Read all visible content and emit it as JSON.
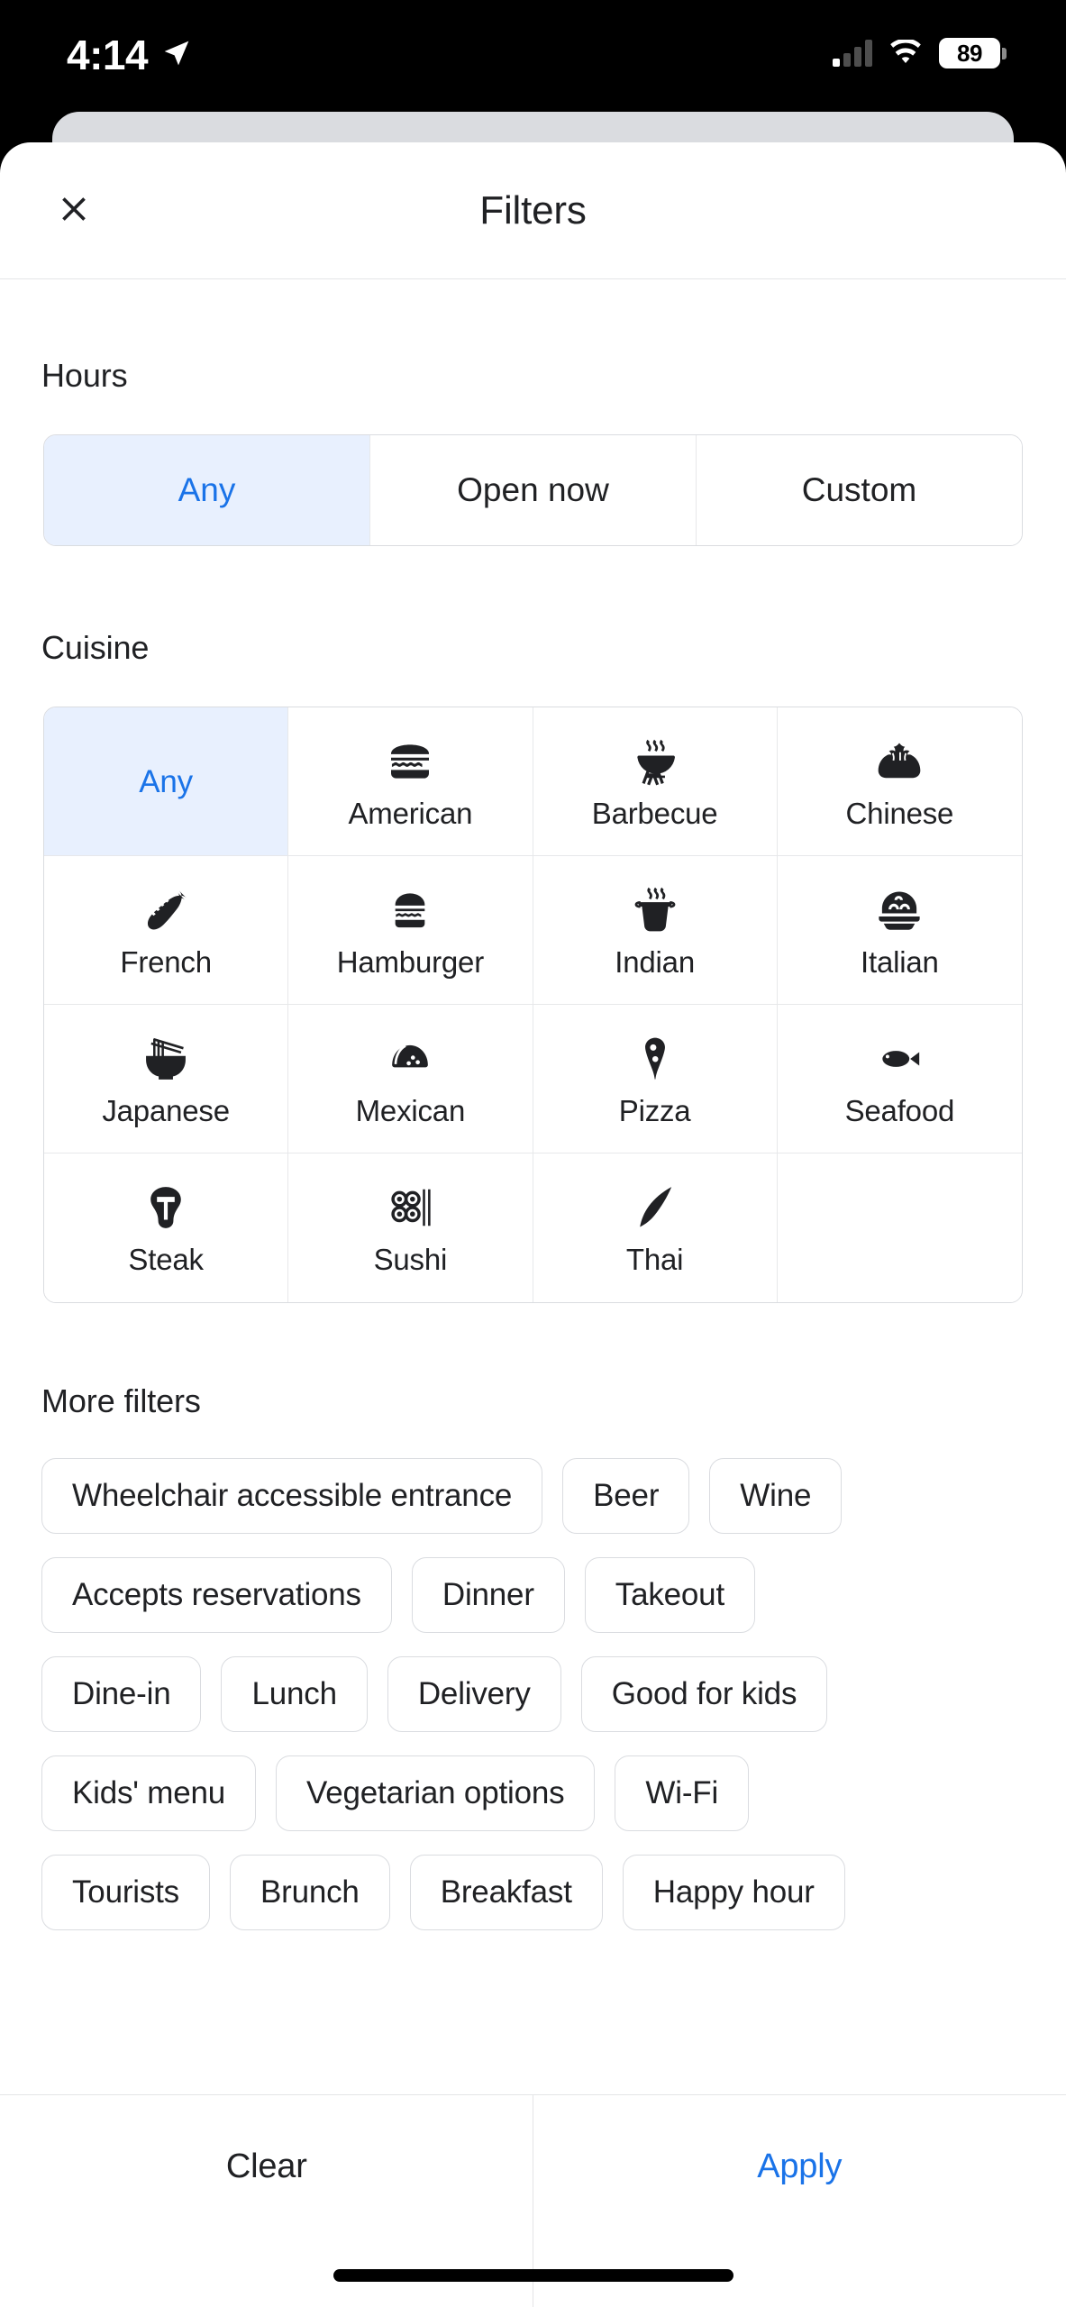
{
  "status_bar": {
    "time": "4:14",
    "location_icon": "location-arrow-icon",
    "signal_icon": "cellular-signal-icon",
    "signal_bars_filled": 1,
    "wifi_icon": "wifi-icon",
    "battery_level": "89",
    "battery_icon": "battery-icon"
  },
  "header": {
    "close_icon": "close-icon",
    "title": "Filters"
  },
  "hours": {
    "label": "Hours",
    "options": [
      {
        "label": "Any",
        "selected": true
      },
      {
        "label": "Open now",
        "selected": false
      },
      {
        "label": "Custom",
        "selected": false
      }
    ]
  },
  "cuisine": {
    "label": "Cuisine",
    "items": [
      {
        "label": "Any",
        "icon": "none",
        "selected": true
      },
      {
        "label": "American",
        "icon": "burger-icon",
        "selected": false
      },
      {
        "label": "Barbecue",
        "icon": "grill-icon",
        "selected": false
      },
      {
        "label": "Chinese",
        "icon": "dumpling-icon",
        "selected": false
      },
      {
        "label": "French",
        "icon": "baguette-icon",
        "selected": false
      },
      {
        "label": "Hamburger",
        "icon": "burger-icon",
        "selected": false
      },
      {
        "label": "Indian",
        "icon": "curry-pot-icon",
        "selected": false
      },
      {
        "label": "Italian",
        "icon": "pasta-bowl-icon",
        "selected": false
      },
      {
        "label": "Japanese",
        "icon": "ramen-bowl-icon",
        "selected": false
      },
      {
        "label": "Mexican",
        "icon": "taco-icon",
        "selected": false
      },
      {
        "label": "Pizza",
        "icon": "pizza-slice-icon",
        "selected": false
      },
      {
        "label": "Seafood",
        "icon": "fish-icon",
        "selected": false
      },
      {
        "label": "Steak",
        "icon": "steak-icon",
        "selected": false
      },
      {
        "label": "Sushi",
        "icon": "sushi-icon",
        "selected": false
      },
      {
        "label": "Thai",
        "icon": "leaf-icon",
        "selected": false
      },
      {
        "label": "",
        "icon": "none",
        "selected": false
      }
    ]
  },
  "more_filters": {
    "label": "More filters",
    "rows": [
      [
        "Wheelchair accessible entrance",
        "Beer",
        "Wine"
      ],
      [
        "Accepts reservations",
        "Dinner",
        "Takeout"
      ],
      [
        "Dine-in",
        "Lunch",
        "Delivery",
        "Good for kids"
      ],
      [
        "Kids' menu",
        "Vegetarian options",
        "Wi-Fi"
      ],
      [
        "Tourists",
        "Brunch",
        "Breakfast",
        "Happy hour"
      ]
    ]
  },
  "actions": {
    "clear_label": "Clear",
    "apply_label": "Apply"
  },
  "colors": {
    "accent": "#1a73e8",
    "accent_bg": "#e8f0fe",
    "text": "#202124",
    "border": "#dadce0"
  }
}
